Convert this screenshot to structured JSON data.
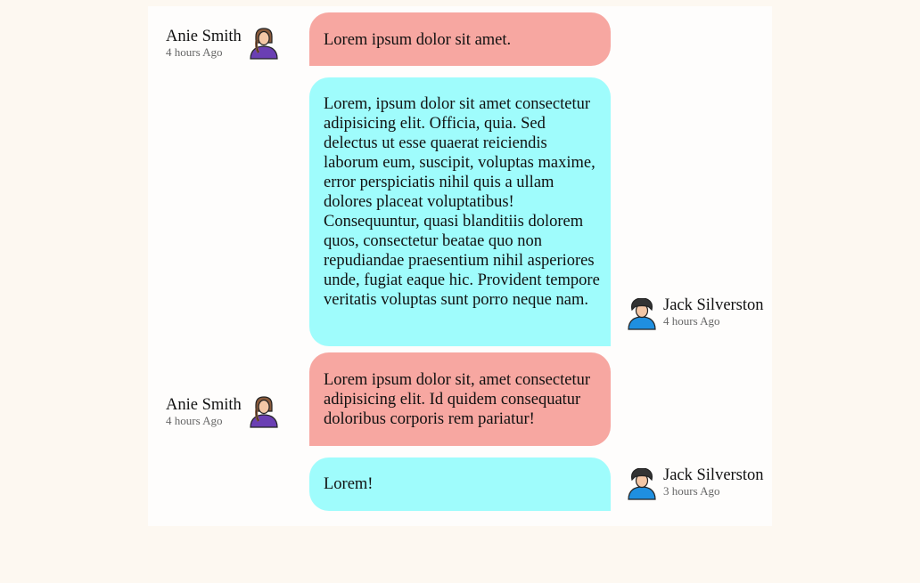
{
  "colors": {
    "page_background": "#fdf8f1",
    "panel_background": "#fefdfc",
    "incoming_bubble": "#f7a7a1",
    "outgoing_bubble": "#9ffcfc"
  },
  "messages": [
    {
      "sender": "Anie Smith",
      "time": "4 hours Ago",
      "avatar": "woman-avatar-icon",
      "side": "left",
      "text": "Lorem ipsum dolor sit amet."
    },
    {
      "sender": "Jack Silverston",
      "time": "4 hours Ago",
      "avatar": "man-avatar-icon",
      "side": "right",
      "text": "Lorem, ipsum dolor sit amet consectetur adipisicing elit. Officia, quia. Sed delectus ut esse quaerat reiciendis laborum eum, suscipit, voluptas maxime, error perspiciatis nihil quis a ullam dolores placeat voluptatibus! Consequuntur, quasi blanditiis dolorem quos, consectetur beatae quo non repudiandae praesentium nihil asperiores unde, fugiat eaque hic. Provident tempore veritatis voluptas sunt porro neque nam."
    },
    {
      "sender": "Anie Smith",
      "time": "4 hours Ago",
      "avatar": "woman-avatar-icon",
      "side": "left",
      "text": "Lorem ipsum dolor sit, amet consectetur adipisicing elit. Id quidem consequatur doloribus corporis rem pariatur!"
    },
    {
      "sender": "Jack Silverston",
      "time": "3 hours Ago",
      "avatar": "man-avatar-icon",
      "side": "right",
      "text": "Lorem!"
    }
  ]
}
